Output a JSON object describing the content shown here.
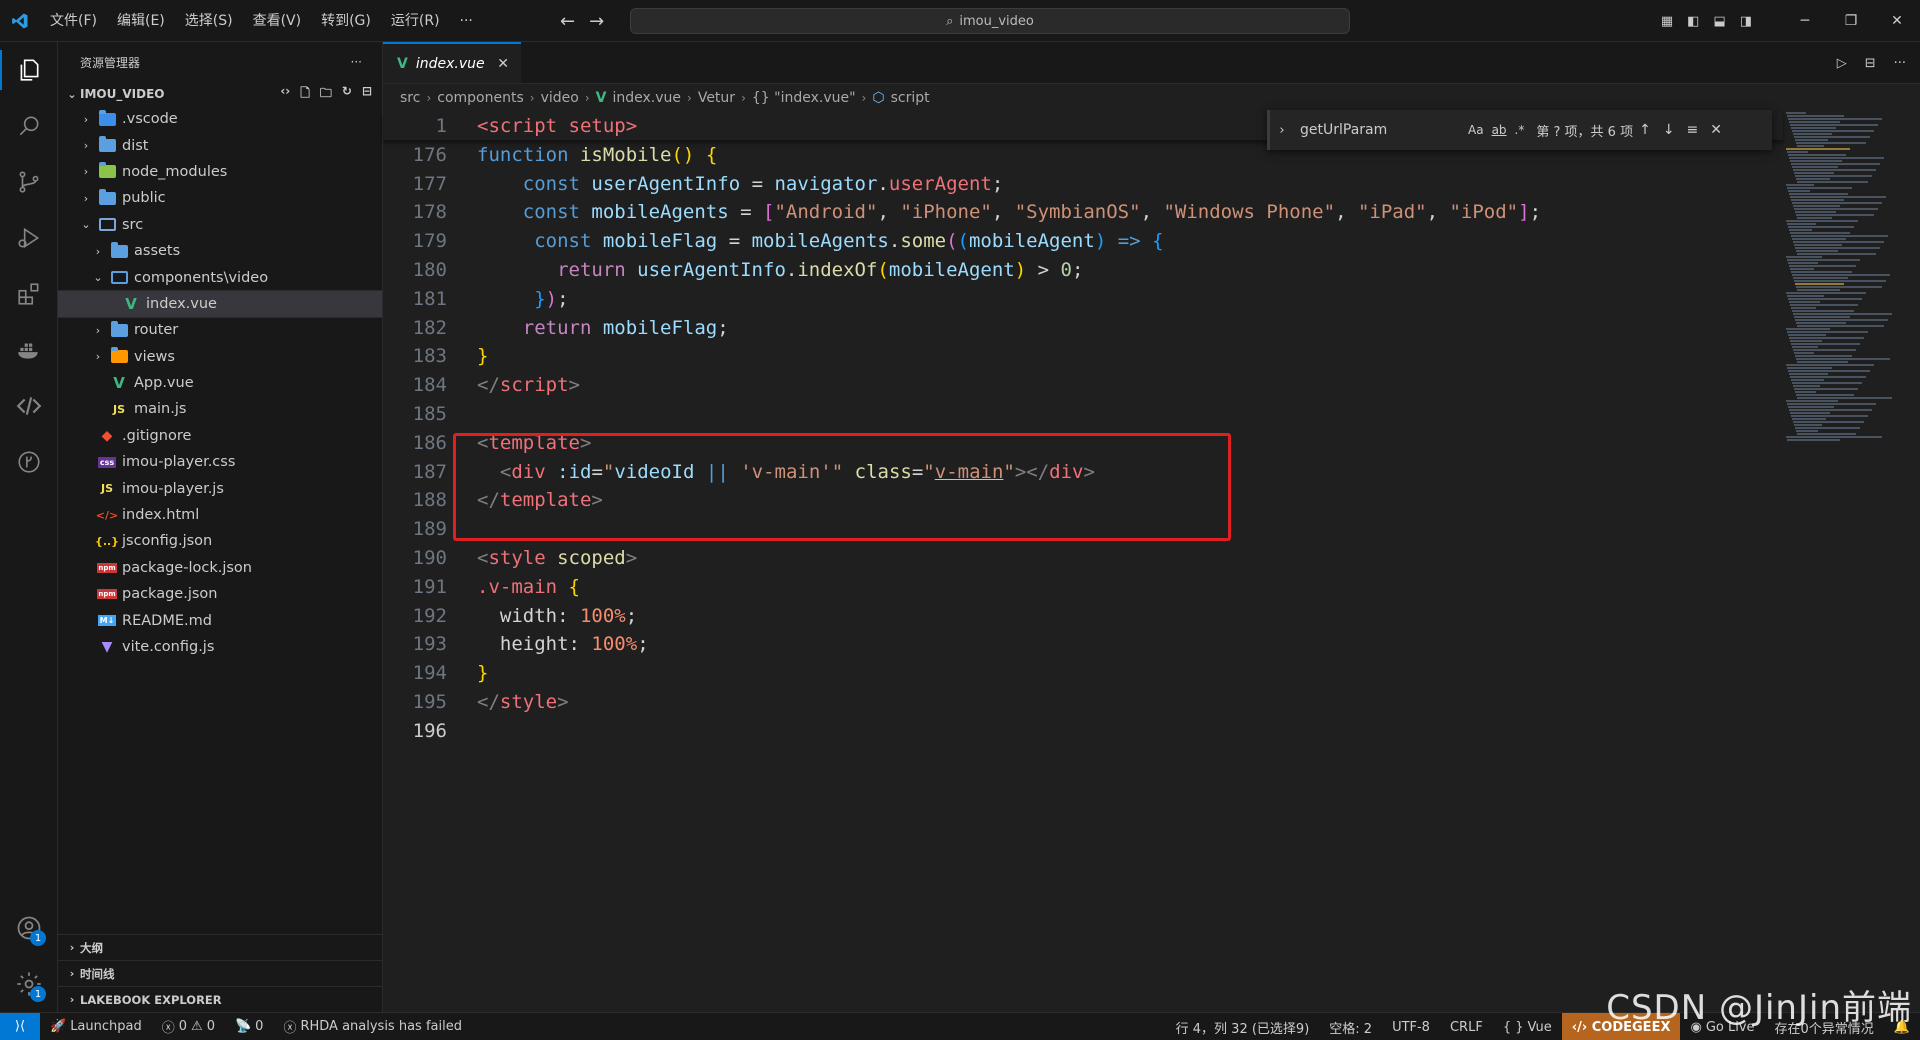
{
  "titlebar": {
    "menu": [
      "文件(F)",
      "编辑(E)",
      "选择(S)",
      "查看(V)",
      "转到(G)",
      "运行(R)",
      "···"
    ],
    "search": "imou_video"
  },
  "sidebar": {
    "title": "资源管理器",
    "more": "···",
    "folder": "IMOU_VIDEO",
    "tree": [
      {
        "label": ".vscode",
        "icon": "vscode-folder-icon",
        "depth": 1,
        "chevron": "›"
      },
      {
        "label": "dist",
        "icon": "folder-icon",
        "depth": 1,
        "chevron": "›"
      },
      {
        "label": "node_modules",
        "icon": "node-folder-icon",
        "depth": 1,
        "chevron": "›"
      },
      {
        "label": "public",
        "icon": "folder-icon",
        "depth": 1,
        "chevron": "›"
      },
      {
        "label": "src",
        "icon": "src-folder-icon",
        "depth": 1,
        "chevron": "⌄"
      },
      {
        "label": "assets",
        "icon": "folder-icon",
        "depth": 2,
        "chevron": "›"
      },
      {
        "label": "components\\video",
        "icon": "folder-open-icon",
        "depth": 2,
        "chevron": "⌄"
      },
      {
        "label": "index.vue",
        "icon": "vue-file-icon",
        "depth": 3,
        "chevron": ""
      },
      {
        "label": "router",
        "icon": "folder-icon",
        "depth": 2,
        "chevron": "›"
      },
      {
        "label": "views",
        "icon": "views-folder-icon",
        "depth": 2,
        "chevron": "›"
      },
      {
        "label": "App.vue",
        "icon": "vue-file-icon",
        "depth": 2,
        "chevron": ""
      },
      {
        "label": "main.js",
        "icon": "js-file-icon",
        "depth": 2,
        "chevron": ""
      },
      {
        "label": ".gitignore",
        "icon": "git-file-icon",
        "depth": 1,
        "chevron": ""
      },
      {
        "label": "imou-player.css",
        "icon": "css-file-icon",
        "depth": 1,
        "chevron": ""
      },
      {
        "label": "imou-player.js",
        "icon": "js-file-icon",
        "depth": 1,
        "chevron": ""
      },
      {
        "label": "index.html",
        "icon": "html-file-icon",
        "depth": 1,
        "chevron": ""
      },
      {
        "label": "jsconfig.json",
        "icon": "json-file-icon",
        "depth": 1,
        "chevron": ""
      },
      {
        "label": "package-lock.json",
        "icon": "npm-file-icon",
        "depth": 1,
        "chevron": ""
      },
      {
        "label": "package.json",
        "icon": "npm-file-icon",
        "depth": 1,
        "chevron": ""
      },
      {
        "label": "README.md",
        "icon": "markdown-file-icon",
        "depth": 1,
        "chevron": ""
      },
      {
        "label": "vite.config.js",
        "icon": "vite-file-icon",
        "depth": 1,
        "chevron": ""
      }
    ],
    "sections": [
      "大纲",
      "时间线",
      "LAKEBOOK EXPLORER"
    ]
  },
  "editor": {
    "tab": "index.vue",
    "breadcrumb": [
      "src",
      "components",
      "video",
      "index.vue",
      "Vetur",
      "{} \"index.vue\"",
      "script"
    ],
    "sticky_line": "1",
    "sticky_text": "<script setup>",
    "line_numbers": [
      "176",
      "177",
      "178",
      "179",
      "180",
      "181",
      "182",
      "183",
      "184",
      "185",
      "186",
      "187",
      "188",
      "189",
      "190",
      "191",
      "192",
      "193",
      "194",
      "195",
      "196"
    ]
  },
  "find": {
    "query": "getUrlParam",
    "opt_case": "Aa",
    "opt_word": "ab",
    "opt_regex": ".*",
    "count": "第 ? 项，共 6 项"
  },
  "statusbar": {
    "launchpad": "Launchpad",
    "errors": "0",
    "warnings": "0",
    "ports": "0",
    "rhda": "RHDA analysis has failed",
    "cursor": "行 4，列 32 (已选择9)",
    "spaces": "空格: 2",
    "encoding": "UTF-8",
    "eol": "CRLF",
    "language": "Vue",
    "codegeex": "CODEGEEX",
    "golive": "Go Live",
    "exceptions": "存在0个异常情况"
  },
  "watermark": "CSDN @JinJin前端",
  "colors": {
    "accent": "#0078d4",
    "highlight_box": "#e02020",
    "codegeex": "#b5651d"
  }
}
